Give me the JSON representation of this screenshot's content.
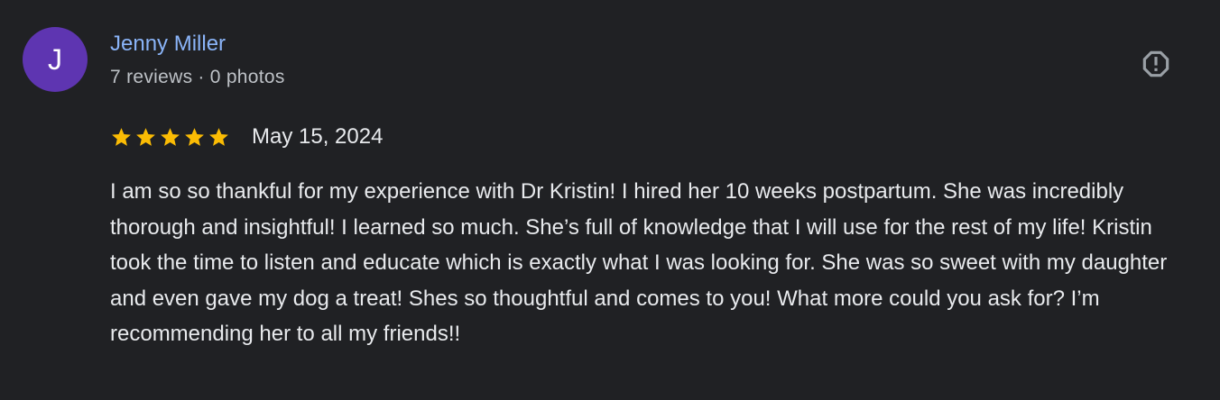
{
  "reviewer": {
    "initial": "J",
    "name": "Jenny Miller",
    "reviews_count": "7 reviews",
    "separator": "·",
    "photos_count": "0 photos",
    "avatar_color": "#5e35b1"
  },
  "report_icon": "report-flag-icon",
  "rating": {
    "stars": 5,
    "max_stars": 5,
    "star_color": "#fbbc04",
    "date": "May 15, 2024"
  },
  "review": {
    "text": "I am so so thankful for my experience with Dr Kristin! I hired her 10 weeks postpartum. She was incredibly thorough and insightful! I learned so much. She’s full of knowledge that I will use for the rest of my life! Kristin took the time to listen and educate which is exactly what I was looking for. She was so sweet with my daughter and even gave my dog a treat! Shes so thoughtful and comes to you! What more could you ask for? I’m recommending her to all my friends!!"
  },
  "colors": {
    "background": "#202124",
    "name": "#8ab4f8",
    "meta": "#bdc1c6",
    "text": "#e8eaed",
    "icon": "#9aa0a6"
  }
}
